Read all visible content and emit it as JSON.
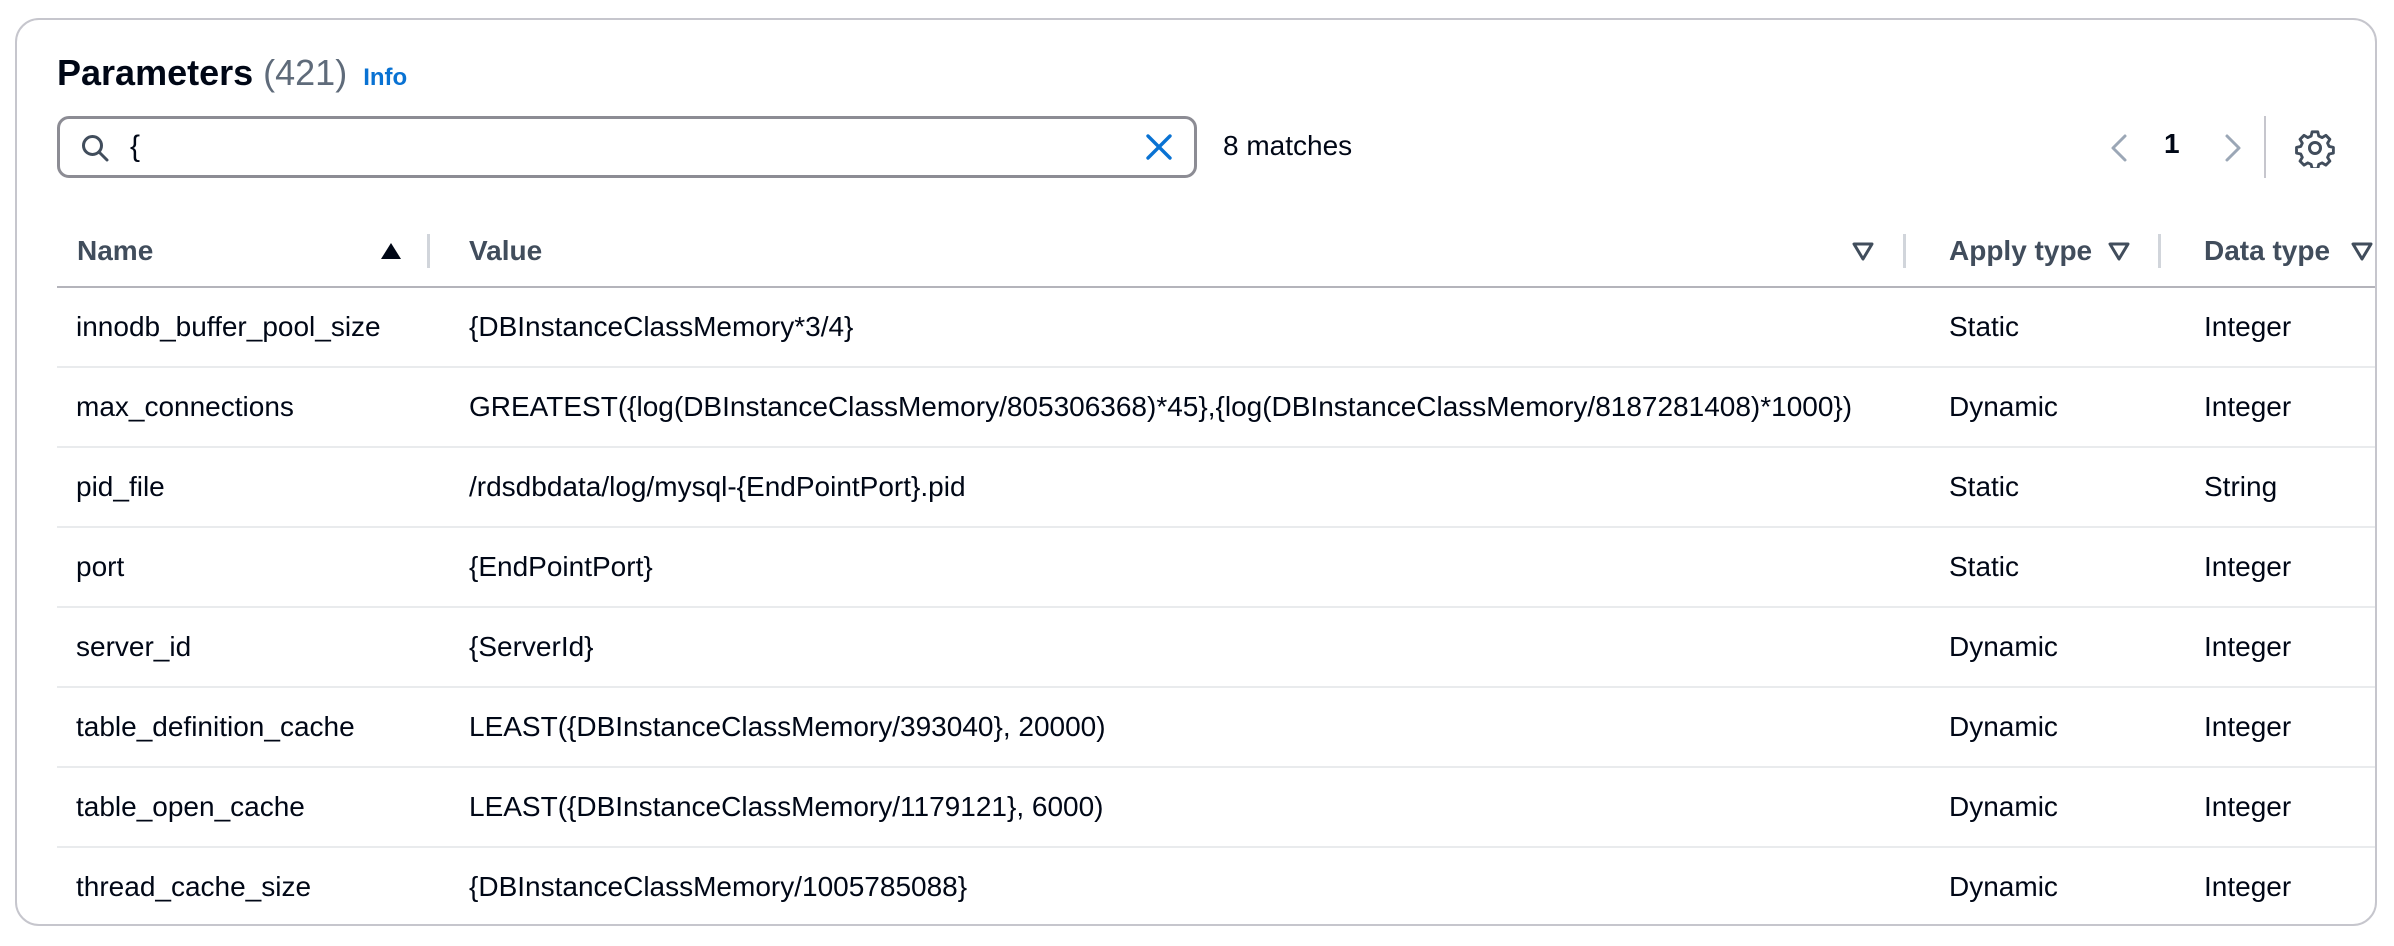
{
  "header": {
    "title": "Parameters",
    "count": "(421)",
    "info_label": "Info"
  },
  "search": {
    "value": "{",
    "match_text": "8 matches"
  },
  "pagination": {
    "current_page": "1"
  },
  "table": {
    "columns": {
      "name": "Name",
      "value": "Value",
      "apply_type": "Apply type",
      "data_type": "Data type"
    },
    "rows": [
      {
        "name": "innodb_buffer_pool_size",
        "value": "{DBInstanceClassMemory*3/4}",
        "apply_type": "Static",
        "data_type": "Integer"
      },
      {
        "name": "max_connections",
        "value": "GREATEST({log(DBInstanceClassMemory/805306368)*45},{log(DBInstanceClassMemory/8187281408)*1000})",
        "apply_type": "Dynamic",
        "data_type": "Integer"
      },
      {
        "name": "pid_file",
        "value": "/rdsdbdata/log/mysql-{EndPointPort}.pid",
        "apply_type": "Static",
        "data_type": "String"
      },
      {
        "name": "port",
        "value": "{EndPointPort}",
        "apply_type": "Static",
        "data_type": "Integer"
      },
      {
        "name": "server_id",
        "value": "{ServerId}",
        "apply_type": "Dynamic",
        "data_type": "Integer"
      },
      {
        "name": "table_definition_cache",
        "value": "LEAST({DBInstanceClassMemory/393040}, 20000)",
        "apply_type": "Dynamic",
        "data_type": "Integer"
      },
      {
        "name": "table_open_cache",
        "value": "LEAST({DBInstanceClassMemory/1179121}, 6000)",
        "apply_type": "Dynamic",
        "data_type": "Integer"
      },
      {
        "name": "thread_cache_size",
        "value": "{DBInstanceClassMemory/1005785088}",
        "apply_type": "Dynamic",
        "data_type": "Integer"
      }
    ]
  },
  "icons": {
    "search": "search-icon",
    "clear": "close-icon",
    "prev": "chevron-left-icon",
    "next": "chevron-right-icon",
    "settings": "gear-icon",
    "sort_asc": "sort-ascending-icon",
    "sort_none": "sort-descending-icon"
  },
  "colors": {
    "link": "#0972d3",
    "text": "#000716",
    "muted": "#5f6b7a",
    "border": "#c6c6cd"
  }
}
